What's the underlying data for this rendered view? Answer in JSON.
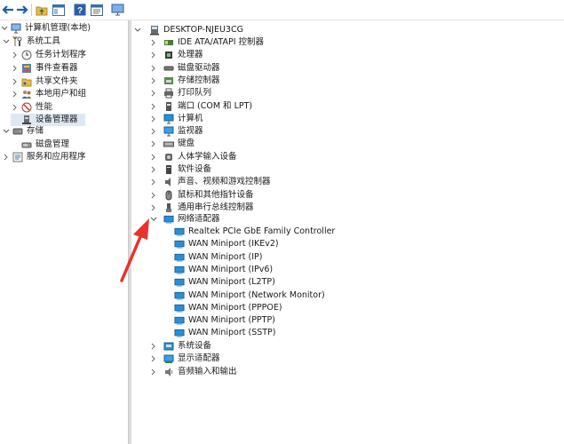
{
  "toolbar": {
    "buttons": [
      "back-icon",
      "forward-icon",
      "up-folder-icon",
      "show-hide-tree-icon",
      "help-icon",
      "properties-icon",
      "computer-monitor-icon"
    ]
  },
  "left_tree": {
    "root": "计算机管理(本地)",
    "system_tools": "系统工具",
    "items": [
      {
        "label": "任务计划程序"
      },
      {
        "label": "事件查看器"
      },
      {
        "label": "共享文件夹"
      },
      {
        "label": "本地用户和组"
      },
      {
        "label": "性能"
      },
      {
        "label": "设备管理器"
      }
    ],
    "storage": "存储",
    "disk_mgmt": "磁盘管理",
    "services": "服务和应用程序"
  },
  "device_tree": {
    "root": "DESKTOP-NJEU3CG",
    "categories_before": [
      {
        "label": "IDE ATA/ATAPI 控制器",
        "icon": "ide-controller-icon"
      },
      {
        "label": "处理器",
        "icon": "processor-icon"
      },
      {
        "label": "磁盘驱动器",
        "icon": "disk-drive-icon"
      },
      {
        "label": "存储控制器",
        "icon": "storage-controller-icon"
      },
      {
        "label": "打印队列",
        "icon": "printer-icon"
      },
      {
        "label": "端口 (COM 和 LPT)",
        "icon": "port-icon"
      },
      {
        "label": "计算机",
        "icon": "computer-icon"
      },
      {
        "label": "监视器",
        "icon": "monitor-icon"
      },
      {
        "label": "键盘",
        "icon": "keyboard-icon"
      },
      {
        "label": "人体学输入设备",
        "icon": "hid-icon"
      },
      {
        "label": "软件设备",
        "icon": "software-device-icon"
      },
      {
        "label": "声音、视频和游戏控制器",
        "icon": "sound-icon"
      },
      {
        "label": "鼠标和其他指针设备",
        "icon": "mouse-icon"
      },
      {
        "label": "通用串行总线控制器",
        "icon": "usb-icon"
      }
    ],
    "network": {
      "label": "网络适配器",
      "children": [
        "Realtek PCIe GbE Family Controller",
        "WAN Miniport (IKEv2)",
        "WAN Miniport (IP)",
        "WAN Miniport (IPv6)",
        "WAN Miniport (L2TP)",
        "WAN Miniport (Network Monitor)",
        "WAN Miniport (PPPOE)",
        "WAN Miniport (PPTP)",
        "WAN Miniport (SSTP)"
      ]
    },
    "categories_after": [
      {
        "label": "系统设备",
        "icon": "system-device-icon"
      },
      {
        "label": "显示适配器",
        "icon": "display-adapter-icon"
      },
      {
        "label": "音频输入和输出",
        "icon": "audio-io-icon"
      }
    ]
  },
  "colors": {
    "annotation_arrow": "#e8322c",
    "network_icon": "#2a8fd6",
    "selection": "#dde8f3"
  }
}
